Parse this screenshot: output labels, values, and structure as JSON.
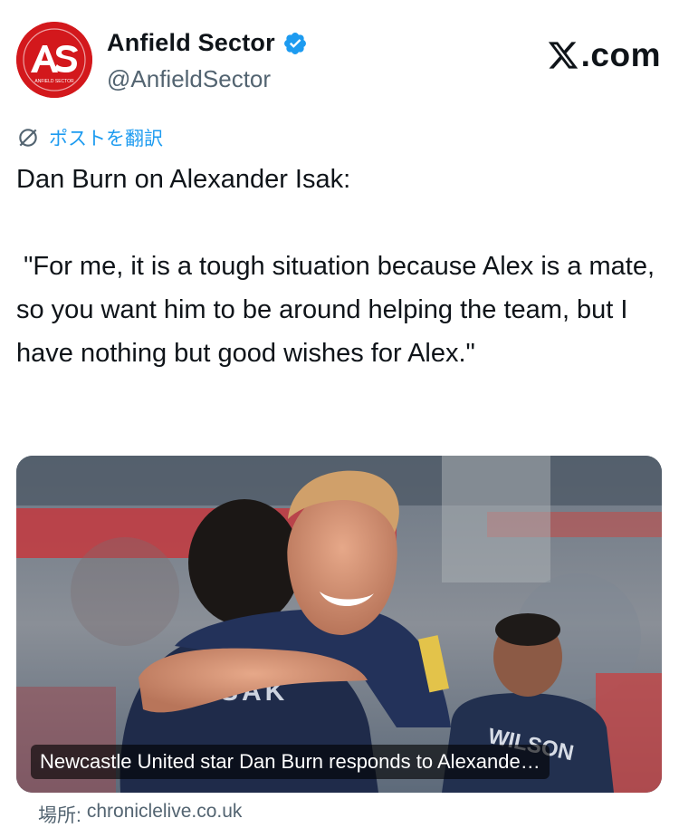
{
  "author": {
    "name": "Anfield Sector",
    "handle": "@AnfieldSector",
    "avatar_text": "AS",
    "avatar_subtext": "ANFIELD SECTOR",
    "verified": true
  },
  "site_logo": {
    "text": ".com",
    "icon": "x-logo-icon"
  },
  "translate": {
    "label": "ポストを翻訳",
    "icon": "translate-icon"
  },
  "tweet": {
    "text": "Dan Burn on Alexander Isak:\n\n \"For me, it is a tough situation because Alex is a mate, so you want him to be around helping the team, but I have nothing but good wishes for Alex.\""
  },
  "media": {
    "caption": "Newcastle United star Dan Burn responds to Alexande…",
    "jersey_texts": [
      "SAK",
      "WILSON"
    ]
  },
  "link_source": {
    "prefix": "場所:",
    "domain": "chroniclelive.co.uk"
  },
  "colors": {
    "accent": "#1d9bf0",
    "text_primary": "#0f1419",
    "text_secondary": "#536471",
    "avatar_bg": "#d3181c"
  }
}
